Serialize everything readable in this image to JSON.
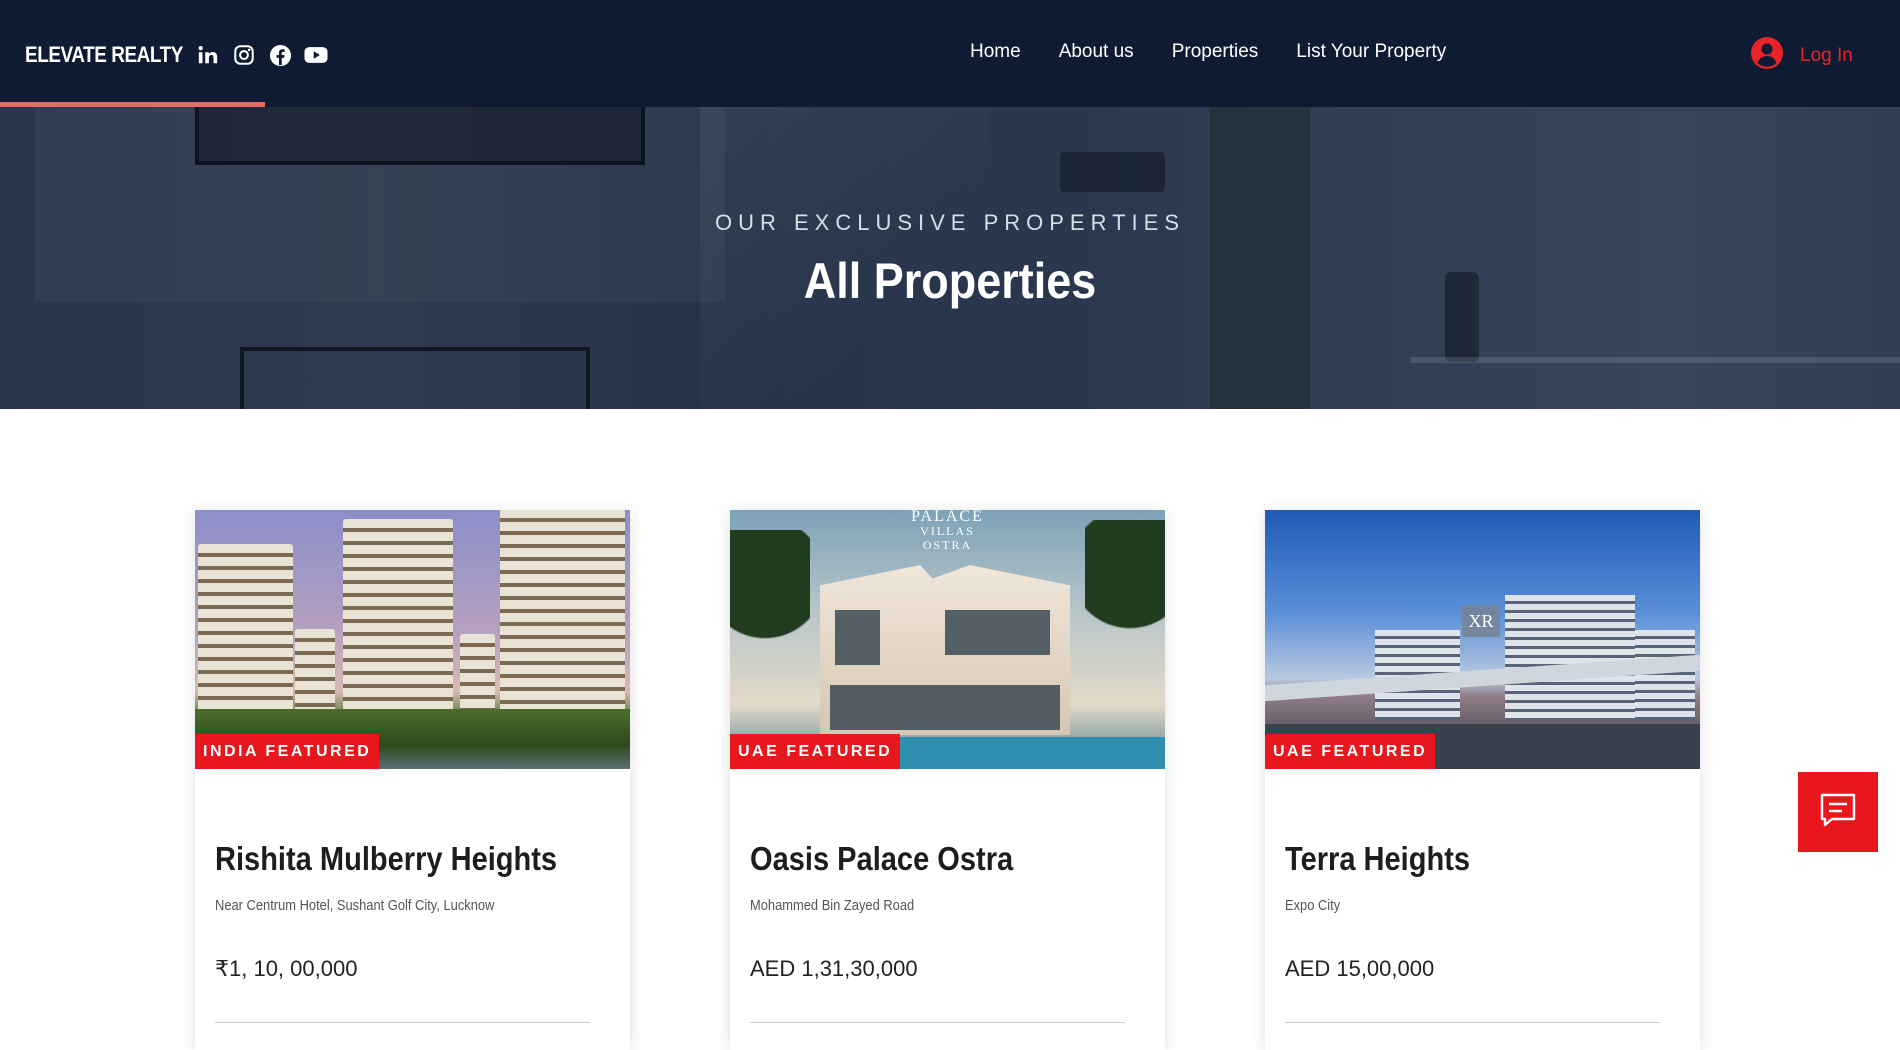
{
  "header": {
    "brand": "ELEVATE REALTY",
    "social": [
      "linkedin-icon",
      "instagram-icon",
      "facebook-icon",
      "youtube-icon"
    ],
    "nav": [
      "Home",
      "About us",
      "Properties",
      "List Your Property"
    ],
    "login_label": "Log In"
  },
  "hero": {
    "eyebrow": "OUR EXCLUSIVE PROPERTIES",
    "title": "All Properties"
  },
  "properties": [
    {
      "badge": "INDIA FEATURED",
      "name": "Rishita Mulberry Heights",
      "location": "Near Centrum Hotel, Sushant Golf City, Lucknow",
      "price": "₹1, 10, 00,000"
    },
    {
      "badge": "UAE FEATURED",
      "name": "Oasis Palace Ostra",
      "location": "Mohammed Bin Zayed Road",
      "price": "AED 1,31,30,000",
      "image_text": [
        "PALACE",
        "VILLAS",
        "OSTRA"
      ]
    },
    {
      "badge": "UAE FEATURED",
      "name": "Terra Heights",
      "location": "Expo City",
      "price": "AED 15,00,000",
      "image_text": "XR"
    }
  ],
  "colors": {
    "header_bg": "#0e1b33",
    "accent_red": "#e8171e",
    "header_underline": "#e96a62",
    "login_red": "#e8242a"
  },
  "chat_icon": "chat-icon"
}
